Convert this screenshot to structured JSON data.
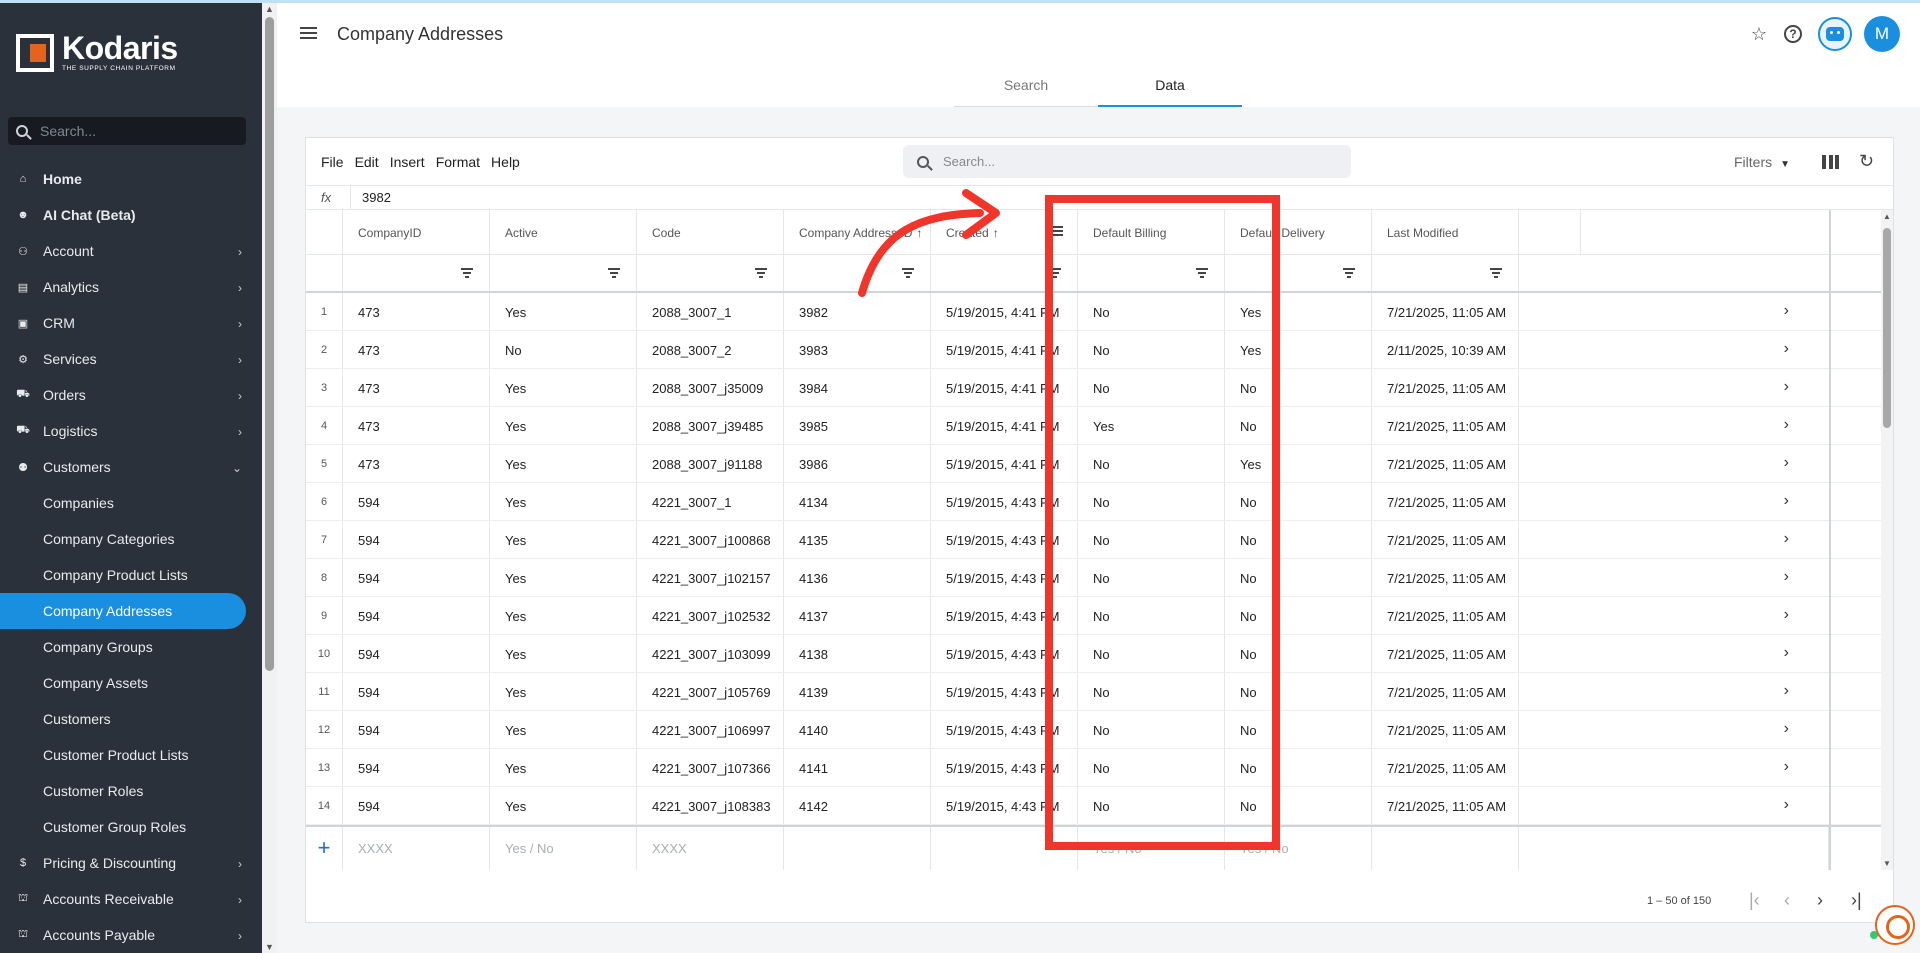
{
  "sidebar": {
    "logo_name": "Kodaris",
    "logo_tagline": "THE SUPPLY CHAIN PLATFORM",
    "search_placeholder": "Search...",
    "items": [
      {
        "label": "Home",
        "icon": "home-icon",
        "glyph": "⌂",
        "chevron": "",
        "bold": true
      },
      {
        "label": "AI Chat (Beta)",
        "icon": "robot-icon",
        "glyph": "☻",
        "chevron": "",
        "bold": true
      },
      {
        "label": "Account",
        "icon": "person-icon",
        "glyph": "⚇",
        "chevron": "›"
      },
      {
        "label": "Analytics",
        "icon": "chart-icon",
        "glyph": "▤",
        "chevron": "›"
      },
      {
        "label": "CRM",
        "icon": "contacts-icon",
        "glyph": "▣",
        "chevron": "›"
      },
      {
        "label": "Services",
        "icon": "services-icon",
        "glyph": "⚙",
        "chevron": "›"
      },
      {
        "label": "Orders",
        "icon": "truck-icon",
        "glyph": "⛟",
        "chevron": "›"
      },
      {
        "label": "Logistics",
        "icon": "logistics-icon",
        "glyph": "⛟",
        "chevron": "›"
      },
      {
        "label": "Customers",
        "icon": "group-icon",
        "glyph": "⚉",
        "chevron": "⌄"
      }
    ],
    "sub_items": [
      "Companies",
      "Company Categories",
      "Company Product Lists",
      "Company Addresses",
      "Company Groups",
      "Company Assets",
      "Customers",
      "Customer Product Lists",
      "Customer Roles",
      "Customer Group Roles"
    ],
    "bottom_items": [
      {
        "label": "Pricing & Discounting",
        "icon": "dollar-icon",
        "glyph": "$",
        "chevron": "›"
      },
      {
        "label": "Accounts Receivable",
        "icon": "bank-icon",
        "glyph": "⛫",
        "chevron": "›"
      },
      {
        "label": "Accounts Payable",
        "icon": "bank-icon",
        "glyph": "⛫",
        "chevron": "›"
      }
    ]
  },
  "header": {
    "title": "Company Addresses",
    "avatar_initial": "M"
  },
  "tabs": {
    "search": "Search",
    "data": "Data"
  },
  "toolbar": {
    "menu": [
      "File",
      "Edit",
      "Insert",
      "Format",
      "Help"
    ],
    "search_placeholder": "Search...",
    "filters_label": "Filters"
  },
  "formula": {
    "label": "fx",
    "value": "3982"
  },
  "grid": {
    "columns": [
      "CompanyID",
      "Active",
      "Code",
      "Company Address ID",
      "Created",
      "Default Billing",
      "Default Delivery",
      "Last Modified"
    ],
    "rows": [
      [
        "1",
        "473",
        "Yes",
        "2088_3007_1",
        "3982",
        "5/19/2015, 4:41 PM",
        "No",
        "Yes",
        "7/21/2025, 11:05 AM"
      ],
      [
        "2",
        "473",
        "No",
        "2088_3007_2",
        "3983",
        "5/19/2015, 4:41 PM",
        "No",
        "Yes",
        "2/11/2025, 10:39 AM"
      ],
      [
        "3",
        "473",
        "Yes",
        "2088_3007_j35009",
        "3984",
        "5/19/2015, 4:41 PM",
        "No",
        "No",
        "7/21/2025, 11:05 AM"
      ],
      [
        "4",
        "473",
        "Yes",
        "2088_3007_j39485",
        "3985",
        "5/19/2015, 4:41 PM",
        "Yes",
        "No",
        "7/21/2025, 11:05 AM"
      ],
      [
        "5",
        "473",
        "Yes",
        "2088_3007_j91188",
        "3986",
        "5/19/2015, 4:41 PM",
        "No",
        "Yes",
        "7/21/2025, 11:05 AM"
      ],
      [
        "6",
        "594",
        "Yes",
        "4221_3007_1",
        "4134",
        "5/19/2015, 4:43 PM",
        "No",
        "No",
        "7/21/2025, 11:05 AM"
      ],
      [
        "7",
        "594",
        "Yes",
        "4221_3007_j100868",
        "4135",
        "5/19/2015, 4:43 PM",
        "No",
        "No",
        "7/21/2025, 11:05 AM"
      ],
      [
        "8",
        "594",
        "Yes",
        "4221_3007_j102157",
        "4136",
        "5/19/2015, 4:43 PM",
        "No",
        "No",
        "7/21/2025, 11:05 AM"
      ],
      [
        "9",
        "594",
        "Yes",
        "4221_3007_j102532",
        "4137",
        "5/19/2015, 4:43 PM",
        "No",
        "No",
        "7/21/2025, 11:05 AM"
      ],
      [
        "10",
        "594",
        "Yes",
        "4221_3007_j103099",
        "4138",
        "5/19/2015, 4:43 PM",
        "No",
        "No",
        "7/21/2025, 11:05 AM"
      ],
      [
        "11",
        "594",
        "Yes",
        "4221_3007_j105769",
        "4139",
        "5/19/2015, 4:43 PM",
        "No",
        "No",
        "7/21/2025, 11:05 AM"
      ],
      [
        "12",
        "594",
        "Yes",
        "4221_3007_j106997",
        "4140",
        "5/19/2015, 4:43 PM",
        "No",
        "No",
        "7/21/2025, 11:05 AM"
      ],
      [
        "13",
        "594",
        "Yes",
        "4221_3007_j107366",
        "4141",
        "5/19/2015, 4:43 PM",
        "No",
        "No",
        "7/21/2025, 11:05 AM"
      ],
      [
        "14",
        "594",
        "Yes",
        "4221_3007_j108383",
        "4142",
        "5/19/2015, 4:43 PM",
        "No",
        "No",
        "7/21/2025, 11:05 AM"
      ]
    ],
    "new_row_placeholders": [
      "XXXX",
      "Yes / No",
      "XXXX",
      "",
      "",
      "Yes / No",
      "Yes / No",
      ""
    ],
    "add_row_symbol": "+"
  },
  "pager": {
    "range": "1 – 50 of 150"
  },
  "colors": {
    "accent": "#1a8fe0",
    "sidebar_bg": "#2b313b",
    "highlight": "#f0352a",
    "brand_orange": "#e4631d"
  }
}
